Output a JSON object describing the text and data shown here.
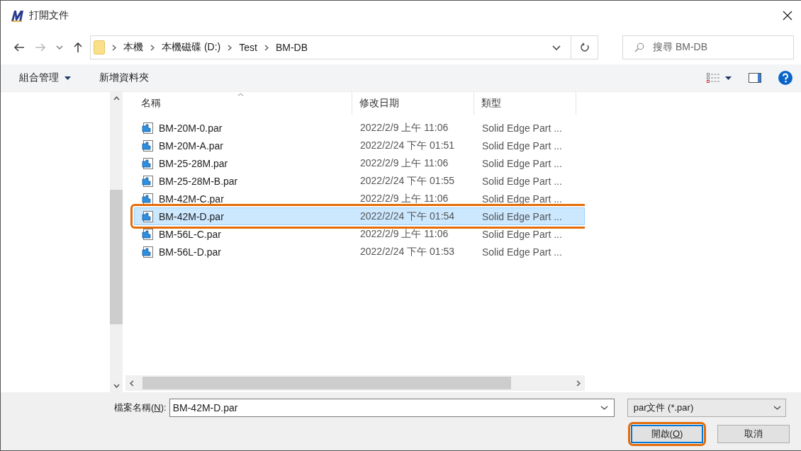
{
  "window": {
    "title": "打開文件"
  },
  "breadcrumb": [
    "本機",
    "本機磁碟 (D:)",
    "Test",
    "BM-DB"
  ],
  "search": {
    "placeholder": "搜尋 BM-DB"
  },
  "toolbar": {
    "organize": "組合管理",
    "new_folder": "新增資料夾"
  },
  "table": {
    "columns": [
      "名稱",
      "修改日期",
      "類型"
    ],
    "rows": [
      {
        "name": "BM-20M-0.par",
        "date": "2022/2/9 上午 11:06",
        "type": "Solid Edge Part ...",
        "selected": false,
        "highlighted": false
      },
      {
        "name": "BM-20M-A.par",
        "date": "2022/2/24 下午 01:51",
        "type": "Solid Edge Part ...",
        "selected": false,
        "highlighted": false
      },
      {
        "name": "BM-25-28M.par",
        "date": "2022/2/9 上午 11:06",
        "type": "Solid Edge Part ...",
        "selected": false,
        "highlighted": false
      },
      {
        "name": "BM-25-28M-B.par",
        "date": "2022/2/24 下午 01:55",
        "type": "Solid Edge Part ...",
        "selected": false,
        "highlighted": false
      },
      {
        "name": "BM-42M-C.par",
        "date": "2022/2/9 上午 11:06",
        "type": "Solid Edge Part ...",
        "selected": false,
        "highlighted": false
      },
      {
        "name": "BM-42M-D.par",
        "date": "2022/2/24 下午 01:54",
        "type": "Solid Edge Part ...",
        "selected": true,
        "highlighted": true
      },
      {
        "name": "BM-56L-C.par",
        "date": "2022/2/9 上午 11:06",
        "type": "Solid Edge Part ...",
        "selected": false,
        "highlighted": false
      },
      {
        "name": "BM-56L-D.par",
        "date": "2022/2/24 下午 01:53",
        "type": "Solid Edge Part ...",
        "selected": false,
        "highlighted": false
      }
    ]
  },
  "filename": {
    "label_before": "檔案名稱(",
    "mnemonic": "N",
    "label_after": "):",
    "value": "BM-42M-D.par"
  },
  "filter": {
    "value": "par文件 (*.par)"
  },
  "buttons": [
    {
      "label_before": "開啟(",
      "mnemonic": "O",
      "label_after": ")",
      "kind": "primary",
      "highlighted": true
    },
    {
      "label_before": "取消",
      "kind": "normal",
      "highlighted": false
    }
  ]
}
